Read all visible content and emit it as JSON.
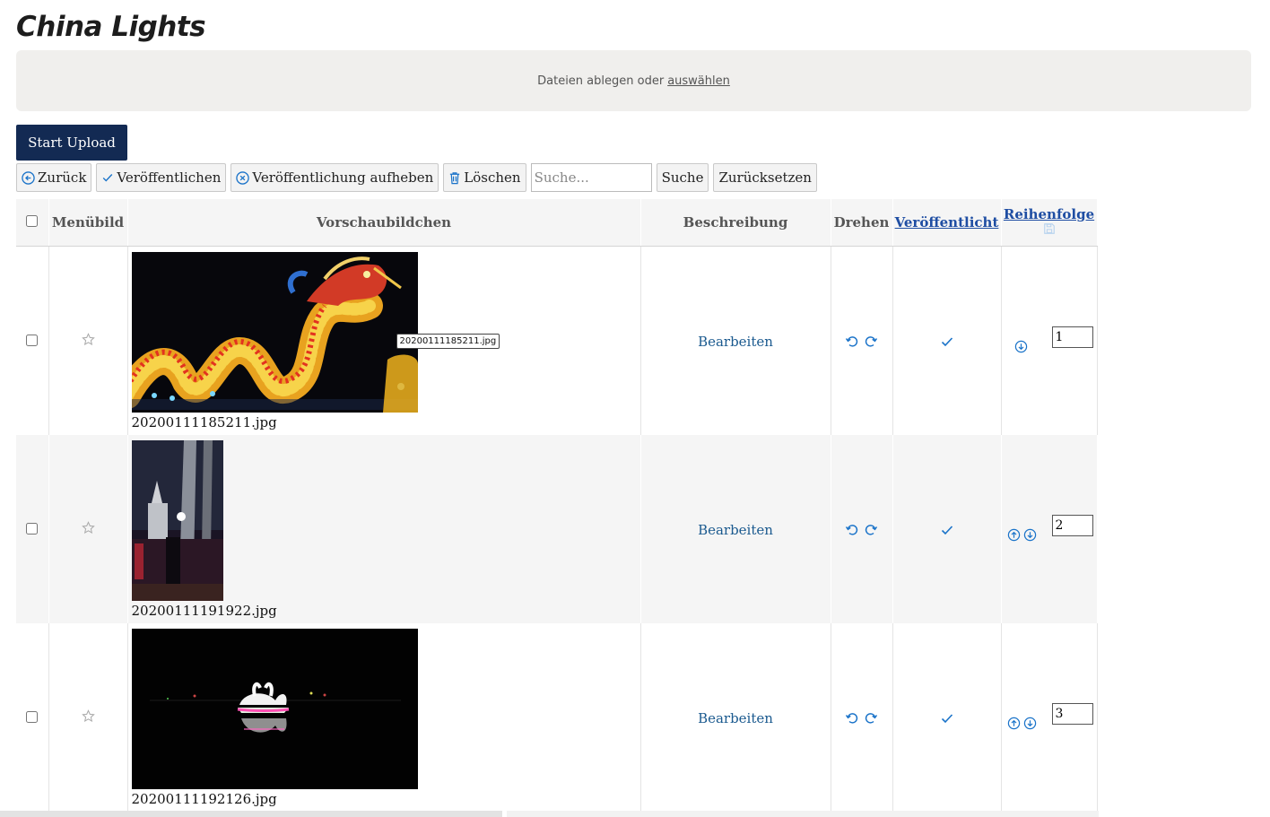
{
  "page": {
    "title": "China Lights"
  },
  "dropzone": {
    "text": "Dateien ablegen oder",
    "link": "auswählen"
  },
  "upload": {
    "button": "Start Upload"
  },
  "toolbar": {
    "back": "Zurück",
    "publish": "Veröffentlichen",
    "unpublish": "Veröffentlichung aufheben",
    "delete": "Löschen",
    "search_placeholder": "Suche...",
    "search": "Suche",
    "reset": "Zurücksetzen"
  },
  "table": {
    "headers": {
      "menubild": "Menübild",
      "preview": "Vorschaubildchen",
      "description": "Beschreibung",
      "rotate": "Drehen",
      "published": "Veröffentlicht",
      "order": "Reihenfolge"
    },
    "rows": [
      {
        "filename": "20200111185211.jpg",
        "edit": "Bearbeiten",
        "order": "1",
        "tooltip": "20200111185211.jpg"
      },
      {
        "filename": "20200111191922.jpg",
        "edit": "Bearbeiten",
        "order": "2"
      },
      {
        "filename": "20200111192126.jpg",
        "edit": "Bearbeiten",
        "order": "3"
      }
    ]
  },
  "colors": {
    "accent": "#1a73c9",
    "upload_bg": "#132a53",
    "header_link": "#1f4ea3"
  }
}
